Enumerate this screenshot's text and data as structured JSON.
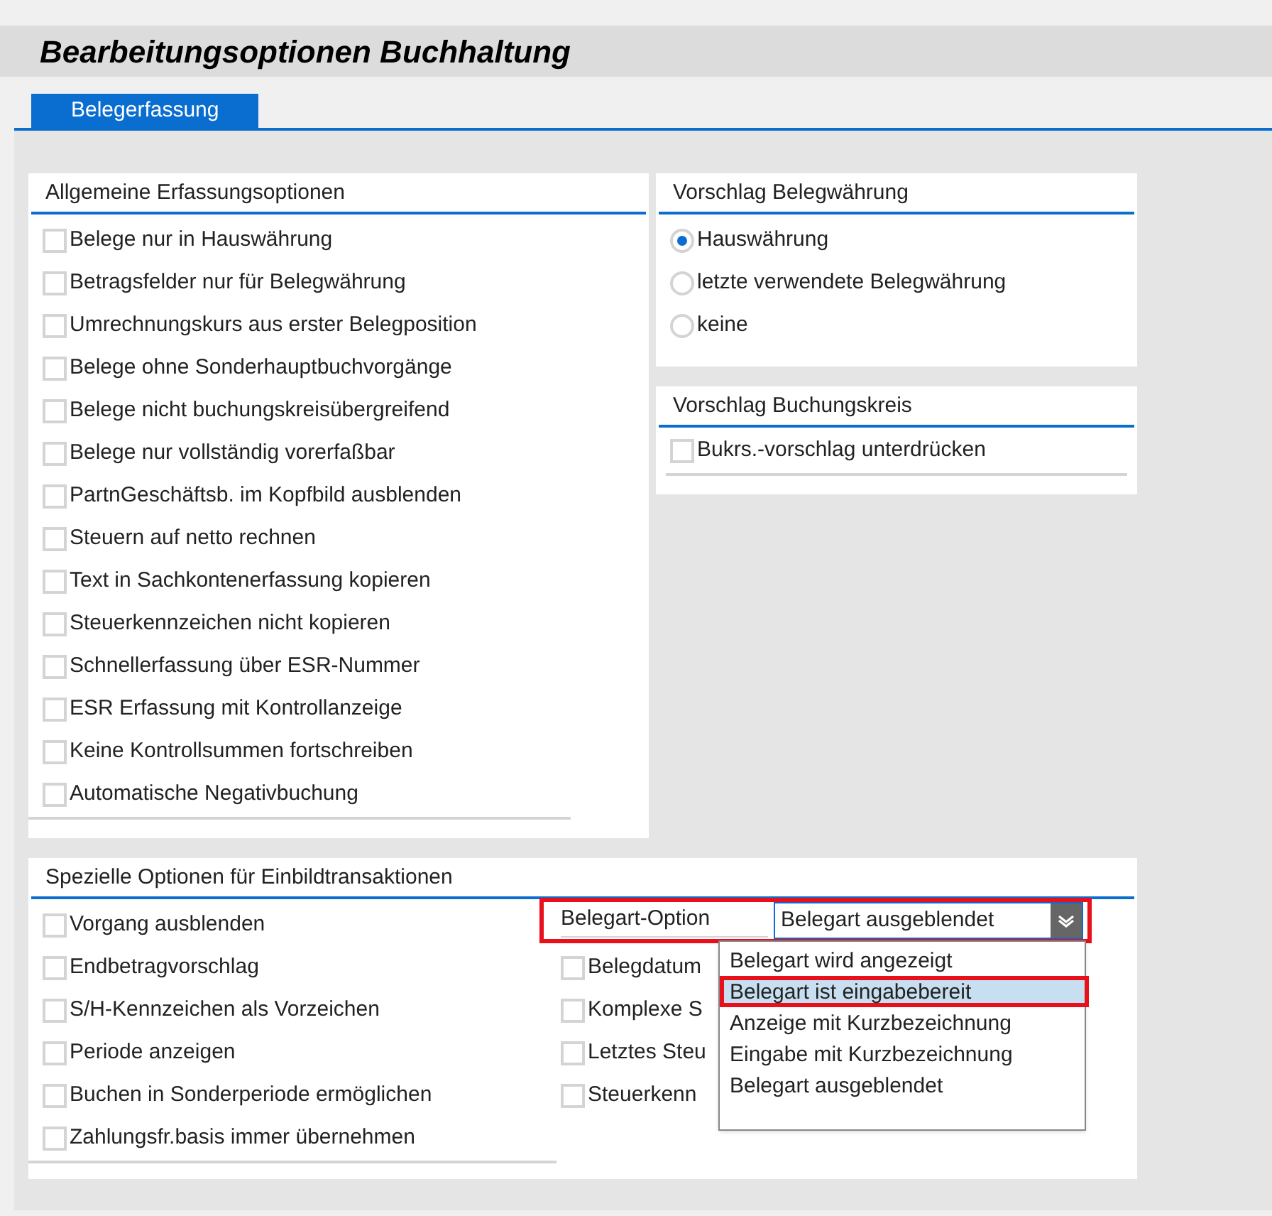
{
  "title": "Bearbeitungsoptionen Buchhaltung",
  "tabs": [
    {
      "label": "Belegerfassung",
      "selected": true
    }
  ],
  "general": {
    "title": "Allgemeine Erfassungsoptionen",
    "options": [
      {
        "label": "Belege nur in Hauswährung",
        "checked": false
      },
      {
        "label": "Betragsfelder nur für Belegwährung",
        "checked": false
      },
      {
        "label": "Umrechnungskurs aus erster Belegposition",
        "checked": false
      },
      {
        "label": "Belege ohne Sonderhauptbuchvorgänge",
        "checked": false
      },
      {
        "label": "Belege nicht buchungskreisübergreifend",
        "checked": false
      },
      {
        "label": "Belege nur vollständig vorerfaßbar",
        "checked": false
      },
      {
        "label": "PartnGeschäftsb. im Kopfbild ausblenden",
        "checked": false
      },
      {
        "label": "Steuern auf netto rechnen",
        "checked": false
      },
      {
        "label": "Text in Sachkontenerfassung kopieren",
        "checked": false
      },
      {
        "label": "Steuerkennzeichen nicht kopieren",
        "checked": false
      },
      {
        "label": "Schnellerfassung über ESR-Nummer",
        "checked": false
      },
      {
        "label": "ESR Erfassung mit Kontrollanzeige",
        "checked": false
      },
      {
        "label": "Keine Kontrollsummen fortschreiben",
        "checked": false
      },
      {
        "label": "Automatische Negativbuchung",
        "checked": false
      }
    ]
  },
  "currency": {
    "title": "Vorschlag Belegwährung",
    "options": [
      {
        "label": "Hauswährung",
        "selected": true
      },
      {
        "label": "letzte verwendete Belegwährung",
        "selected": false
      },
      {
        "label": "keine",
        "selected": false
      }
    ]
  },
  "company_code": {
    "title": "Vorschlag Buchungskreis",
    "options": [
      {
        "label": "Bukrs.-vorschlag unterdrücken",
        "checked": false
      }
    ]
  },
  "special": {
    "title": "Spezielle Optionen für Einbildtransaktionen",
    "options_left": [
      {
        "label": "Vorgang ausblenden",
        "checked": false
      },
      {
        "label": "Endbetragvorschlag",
        "checked": false
      },
      {
        "label": "S/H-Kennzeichen als Vorzeichen",
        "checked": false
      },
      {
        "label": "Periode anzeigen",
        "checked": false
      },
      {
        "label": "Buchen in Sonderperiode ermöglichen",
        "checked": false
      },
      {
        "label": "Zahlungsfr.basis immer übernehmen",
        "checked": false
      }
    ],
    "option_field": {
      "label": "Belegart-Option",
      "value": "Belegart ausgeblendet",
      "expanded": true,
      "options": [
        {
          "label": "Belegart wird angezeigt",
          "highlighted": false
        },
        {
          "label": "Belegart ist eingabebereit",
          "highlighted": true
        },
        {
          "label": "Anzeige mit Kurzbezeichnung",
          "highlighted": false
        },
        {
          "label": "Eingabe mit Kurzbezeichnung",
          "highlighted": false
        },
        {
          "label": "Belegart ausgeblendet",
          "highlighted": false
        }
      ]
    },
    "options_right": [
      {
        "label": "Belegdatum",
        "checked": false
      },
      {
        "label": "Komplexe S",
        "checked": false
      },
      {
        "label": "Letztes Steu",
        "checked": false
      },
      {
        "label": "Steuerkenn",
        "checked": false
      }
    ]
  }
}
